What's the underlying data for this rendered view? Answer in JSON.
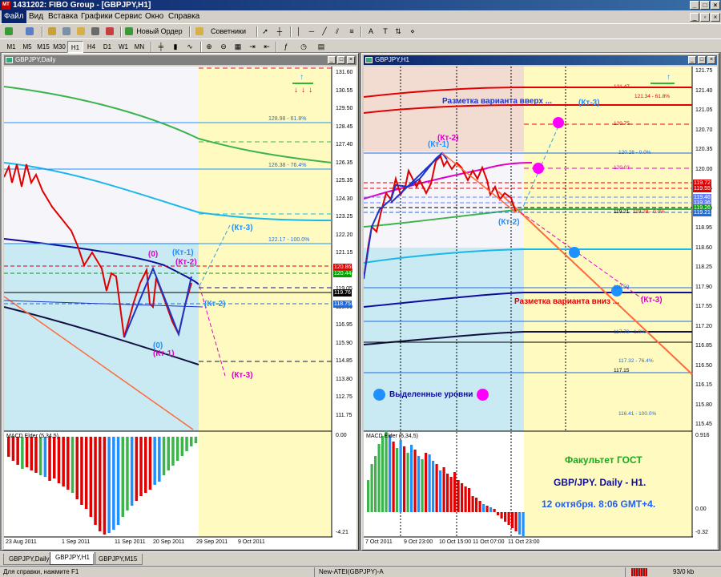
{
  "app": {
    "title": "1431202: FIBO Group - [GBPJPY,H1]",
    "icon_label": "MT"
  },
  "menu": [
    "Файл",
    "Вид",
    "Вставка",
    "Графики",
    "Сервис",
    "Окно",
    "Справка"
  ],
  "toolbar": {
    "new_order": "Новый Ордер",
    "experts": "Советники",
    "timeframes": [
      "M1",
      "M5",
      "M15",
      "M30",
      "H1",
      "H4",
      "D1",
      "W1",
      "MN"
    ],
    "active_timeframe": "H1"
  },
  "left_chart": {
    "window_title": "GBPJPY,Daily",
    "price_ticks": [
      "131.60",
      "130.55",
      "129.50",
      "128.45",
      "127.40",
      "126.35",
      "125.35",
      "124.30",
      "123.25",
      "122.20",
      "121.15",
      "120.10",
      "119.05",
      "118.00",
      "116.95",
      "115.90",
      "114.85",
      "113.80",
      "112.75",
      "111.75"
    ],
    "price_tags": [
      {
        "value": "120.86",
        "color": "#e00000"
      },
      {
        "value": "120.44",
        "color": "#00a000"
      },
      {
        "value": "119.76",
        "color": "#000000"
      },
      {
        "value": "118.75",
        "color": "#1e6be0"
      }
    ],
    "fib_labels": [
      "128.98 - 61.8%",
      "126.38 - 76.4%",
      "122.17 - 100.0%"
    ],
    "annotations": {
      "zero_top": "(0)",
      "kt1_top": "(Кт-1)",
      "kt2_top": "(Кт-2)",
      "zero_bottom": "(0)",
      "kt1_bottom": "(Кт-1)",
      "kt2_right": "(Кт-2)",
      "kt3_up": "(Кт-3)",
      "kt3_down": "(Кт-3)"
    },
    "macd_title": "MACD Elder (5,34,5)",
    "macd_ticks": [
      "0.00",
      "-4.21"
    ],
    "date_ticks": [
      "23 Aug 2011",
      "1 Sep 2011",
      "11 Sep 2011",
      "20 Sep 2011",
      "29 Sep 2011",
      "9 Oct 2011"
    ]
  },
  "right_chart": {
    "window_title": "GBPJPY,H1",
    "price_ticks": [
      "121.75",
      "121.40",
      "121.05",
      "120.70",
      "120.35",
      "120.00",
      "119.65",
      "119.30",
      "118.95",
      "118.60",
      "118.25",
      "117.90",
      "117.55",
      "117.20",
      "116.85",
      "116.50",
      "116.15",
      "115.80",
      "115.45"
    ],
    "price_tags": [
      {
        "value": "119.72",
        "color": "#e00000"
      },
      {
        "value": "119.55",
        "color": "#e00000"
      },
      {
        "value": "119.46",
        "color": "#6080ff"
      },
      {
        "value": "119.36",
        "color": "#6080ff"
      },
      {
        "value": "119.26",
        "color": "#00a000"
      },
      {
        "value": "119.21",
        "color": "#1e6be0"
      }
    ],
    "level_labels": [
      "121.47",
      "121.34 - 61.8%",
      "120.75",
      "120.28 - 0.0%",
      "120.03",
      "119.21",
      "119.28 - 0.0%",
      "118.59",
      "117.79 - 1.0%",
      "117.32 - 76.4%",
      "117.15",
      "116.41 - 100.0%"
    ],
    "annotations": {
      "up_scenario": "Разметка варианта вверх ...",
      "down_scenario": "Разметка варианта вниз ...",
      "kt1": "(Кт-1)",
      "kt2_top": "(Кт-2)",
      "kt2": "(Кт-2)",
      "kt3_up": "(Кт-3)",
      "kt3_down": "(Кт-3)",
      "levels_legend": "Выделенные уровни"
    },
    "overlay_lines": [
      "Факультет ГОСТ",
      "GBP/JPY. Daily - H1.",
      "12 октября. 8:06 GMT+4."
    ],
    "macd_title": "MACD Elder (5,34,5)",
    "macd_ticks": [
      "0.916",
      "0.00",
      "-0.32"
    ],
    "date_ticks": [
      "7 Oct 2011",
      "9 Oct 23:00",
      "10 Oct 15:00",
      "11 Oct 07:00",
      "11 Oct 23:00"
    ]
  },
  "tabs": [
    "GBPJPY,Daily",
    "GBPJPY,H1",
    "GBPJPY,M15"
  ],
  "active_tab": "GBPJPY,H1",
  "status": {
    "help": "Для справки, нажмите F1",
    "profile": "New-ATEI(GBPJPY)-A",
    "traffic": "93/0 kb"
  }
}
